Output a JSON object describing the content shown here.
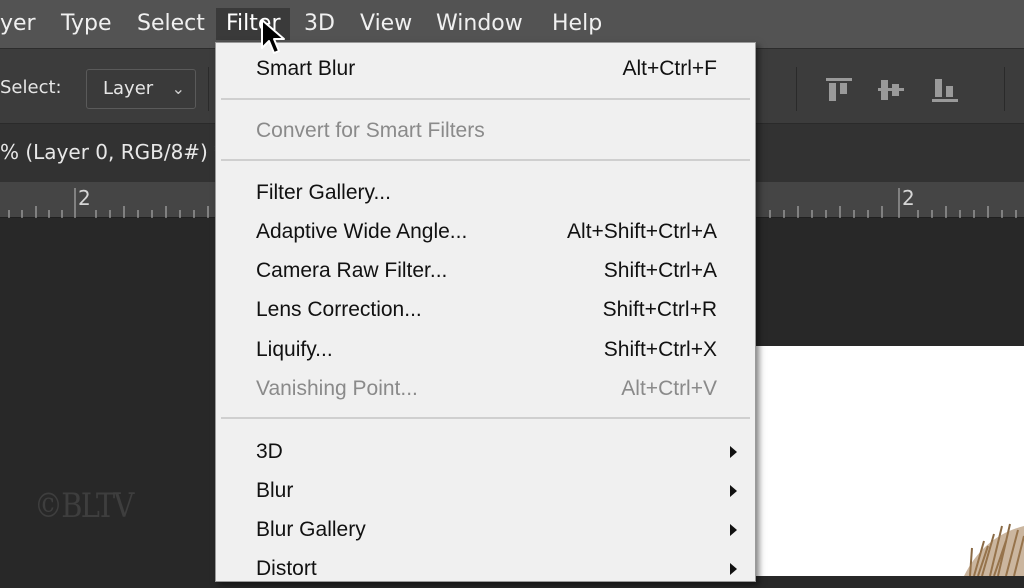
{
  "menubar": {
    "items": [
      "yer",
      "Type",
      "Select",
      "Filter",
      "3D",
      "View",
      "Window",
      "Help"
    ],
    "active": "Filter"
  },
  "options": {
    "select_label": "Select:",
    "select_value": "Layer"
  },
  "document": {
    "tab_title": "% (Layer 0, RGB/8#) *"
  },
  "ruler": {
    "labels": [
      "2",
      "2"
    ]
  },
  "watermark": "©BLTV",
  "filter_menu": {
    "items": [
      {
        "label": "Smart Blur",
        "shortcut": "Alt+Ctrl+F",
        "enabled": true
      },
      {
        "label": "Convert for Smart Filters",
        "shortcut": "",
        "enabled": false
      },
      {
        "label": "Filter Gallery...",
        "shortcut": "",
        "enabled": true
      },
      {
        "label": "Adaptive Wide Angle...",
        "shortcut": "Alt+Shift+Ctrl+A",
        "enabled": true
      },
      {
        "label": "Camera Raw Filter...",
        "shortcut": "Shift+Ctrl+A",
        "enabled": true
      },
      {
        "label": "Lens Correction...",
        "shortcut": "Shift+Ctrl+R",
        "enabled": true
      },
      {
        "label": "Liquify...",
        "shortcut": "Shift+Ctrl+X",
        "enabled": true
      },
      {
        "label": "Vanishing Point...",
        "shortcut": "Alt+Ctrl+V",
        "enabled": false
      },
      {
        "label": "3D",
        "shortcut": "",
        "enabled": true,
        "submenu": true
      },
      {
        "label": "Blur",
        "shortcut": "",
        "enabled": true,
        "submenu": true
      },
      {
        "label": "Blur Gallery",
        "shortcut": "",
        "enabled": true,
        "submenu": true
      },
      {
        "label": "Distort",
        "shortcut": "",
        "enabled": true,
        "submenu": true
      }
    ]
  },
  "colors": {
    "menubar_bg": "#535353",
    "menu_bg": "#f0f0f0",
    "disabled_text": "#8a8a8a"
  }
}
